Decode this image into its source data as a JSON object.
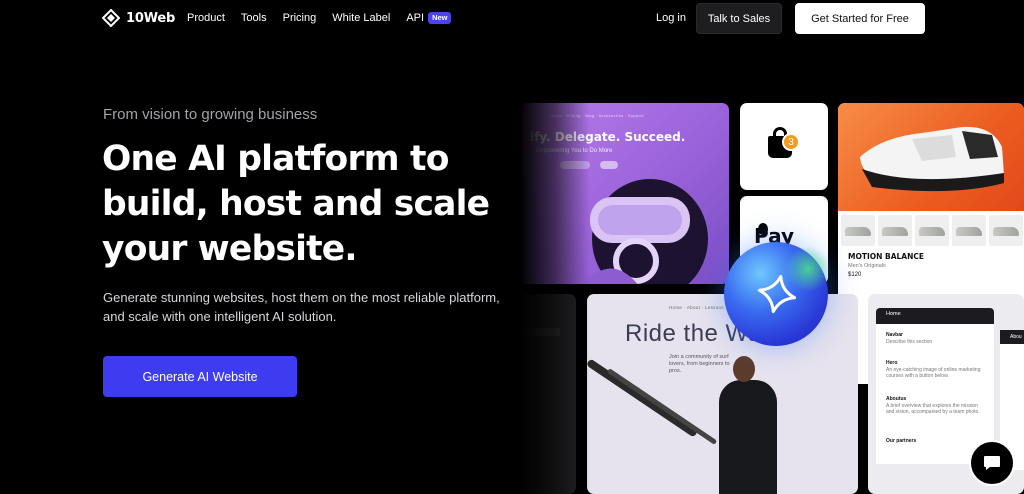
{
  "nav": {
    "logo_text": "10Web",
    "links": [
      "Product",
      "Tools",
      "Pricing",
      "White Label"
    ],
    "api_label": "API",
    "api_badge": "New",
    "login": "Log in",
    "talk_to_sales": "Talk to Sales",
    "get_started": "Get Started for Free"
  },
  "hero": {
    "eyebrow": "From vision to growing business",
    "headline": "One AI platform to build, host and scale your website.",
    "subtext": "Generate stunning websites, host them on the most reliable platform, and scale with one intelligent AI solution.",
    "cta": "Generate AI Website"
  },
  "collage": {
    "vr": {
      "nav": "Home · Pricing · Blog · Accessories · Support",
      "title": "ify. Delegate. Succeed.",
      "sub": "Empowering You to Do More"
    },
    "bag_count": "3",
    "pay_text": "Pay",
    "shoe": {
      "name": "MOTION BALANCE",
      "category": "Men's Originals",
      "price": "$120"
    },
    "wave": {
      "nav": "Home · About · Lessons",
      "title": "Ride the Wave",
      "sub": "Join a community of surf lovers, from beginners to pros."
    },
    "app": {
      "header": "Home",
      "side_header": "Abou",
      "rows": [
        {
          "title": "Navbar",
          "desc": "Describe this section"
        },
        {
          "title": "Hero",
          "desc": "An eye-catching image of online marketing courses with a button below."
        },
        {
          "title": "Aboutus",
          "desc": "A brief overview that explores the mission and vision, accompanied by a team photo."
        },
        {
          "title": "Our partners",
          "desc": ""
        }
      ]
    }
  },
  "colors": {
    "background": "#000000",
    "accent": "#3e3cf0",
    "badge": "#4b44e8"
  },
  "icons": {
    "logo": "10web-logo-icon",
    "chat": "chat-bubble-icon",
    "ai_orb": "ai-star-icon"
  }
}
